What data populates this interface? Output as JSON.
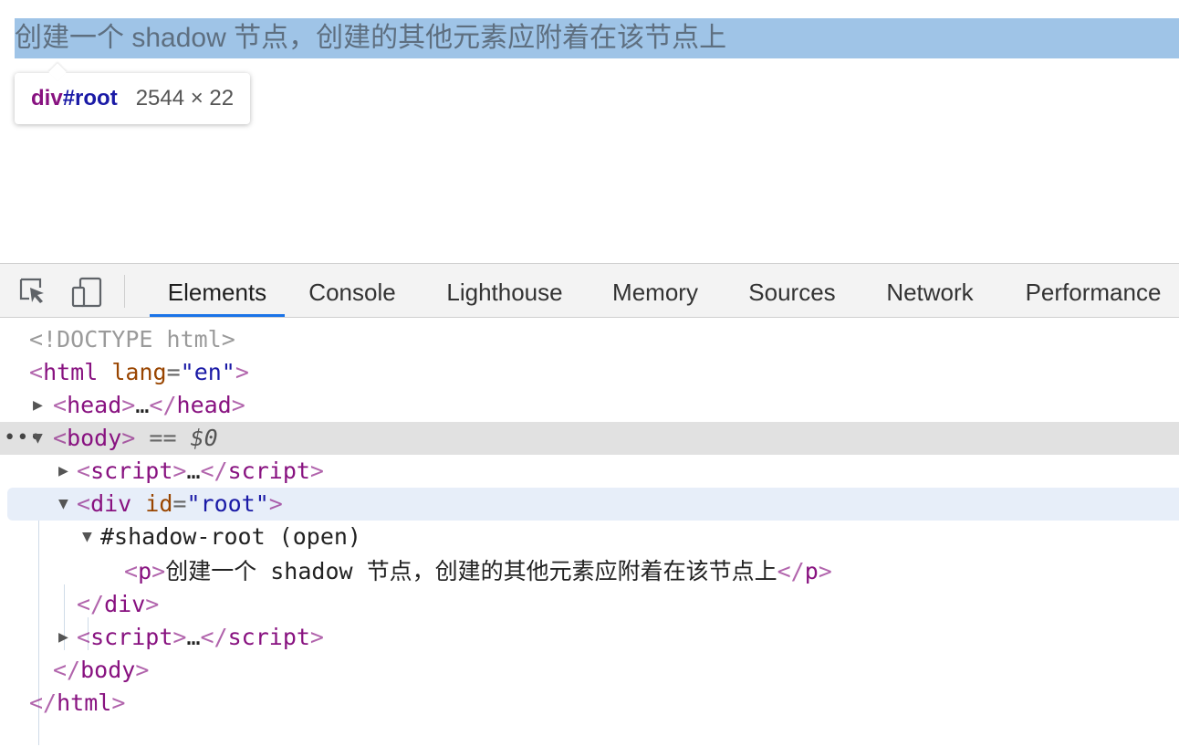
{
  "page": {
    "paragraph_text": "创建一个 shadow 节点，创建的其他元素应附着在该节点上",
    "tooltip": {
      "tag": "div",
      "id": "#root",
      "size": "2544 × 22"
    }
  },
  "devtools": {
    "tabs": [
      {
        "label": "Elements",
        "active": true
      },
      {
        "label": "Console"
      },
      {
        "label": "Lighthouse"
      },
      {
        "label": "Memory"
      },
      {
        "label": "Sources"
      },
      {
        "label": "Network"
      },
      {
        "label": "Performance"
      }
    ],
    "icons": [
      "inspect-element-icon",
      "device-toolbar-icon"
    ],
    "dom": {
      "doctype": "<!DOCTYPE html>",
      "html_open_tag": "html",
      "html_lang_attr": "lang",
      "html_lang_value": "en",
      "head_tag": "head",
      "body_tag": "body",
      "body_marker_eq": "==",
      "body_marker_var": "$0",
      "script_tag": "script",
      "div_tag": "div",
      "div_attr": "id",
      "div_attr_value": "root",
      "shadow_root_label": "#shadow-root (open)",
      "p_tag": "p",
      "p_text": "创建一个 shadow 节点，创建的其他元素应附着在该节点上",
      "ellipsis": "…",
      "dots": "•••"
    }
  },
  "colors": {
    "highlight": "#9fc4e7",
    "tag": "#881280",
    "attr_name": "#994500",
    "attr_value": "#1a1aa6",
    "active_tab_underline": "#1a73e8",
    "selected_row": "#e1e1e1",
    "hover_row": "#e7eef9"
  }
}
